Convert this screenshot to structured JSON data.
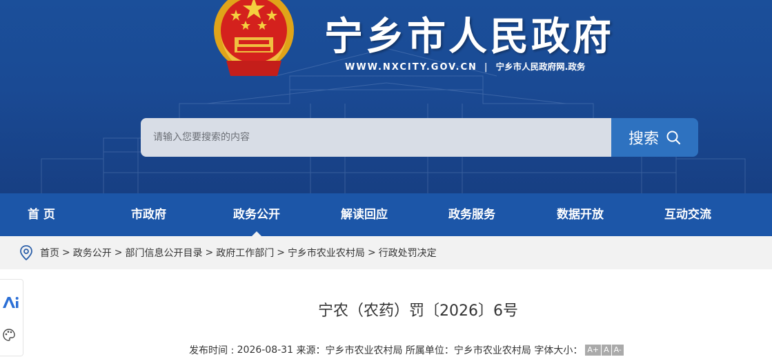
{
  "header": {
    "title": "宁乡市人民政府",
    "domain": "WWW.NXCITY.GOV.CN",
    "separator": "|",
    "subtitle": "宁乡市人民政府网.政务"
  },
  "search": {
    "placeholder": "请输入您要搜索的内容",
    "button_label": "搜索",
    "button_icon": "search-icon"
  },
  "nav": {
    "items": [
      {
        "label": "首 页"
      },
      {
        "label": "市政府"
      },
      {
        "label": "政务公开",
        "active": true
      },
      {
        "label": "解读回应"
      },
      {
        "label": "政务服务"
      },
      {
        "label": "数据开放"
      },
      {
        "label": "互动交流"
      }
    ]
  },
  "breadcrumb": {
    "icon": "location-pin-icon",
    "items": [
      "首页",
      "政务公开",
      "部门信息公开目录",
      "政府工作部门",
      "宁乡市农业农村局",
      "行政处罚决定"
    ],
    "separator": ">"
  },
  "side_float": {
    "icons": [
      "ai-assistant-icon",
      "palette-icon"
    ]
  },
  "article": {
    "title": "宁农（农药）罚〔2026〕6号",
    "meta": {
      "publish_label": "发布时间 :",
      "publish_date": "2026-08-31",
      "source_label": "来源：",
      "source": "宁乡市农业农村局",
      "unit_label": "所属单位：",
      "unit": "宁乡市农业农村局",
      "font_label": "字体大小：",
      "font_sizes": [
        "A+",
        "A",
        "A-"
      ]
    }
  },
  "colors": {
    "banner": "#1a4a94",
    "nav": "#1c56a8",
    "search_button": "#2e72c0",
    "breadcrumb_bg": "#f2f2f2"
  }
}
